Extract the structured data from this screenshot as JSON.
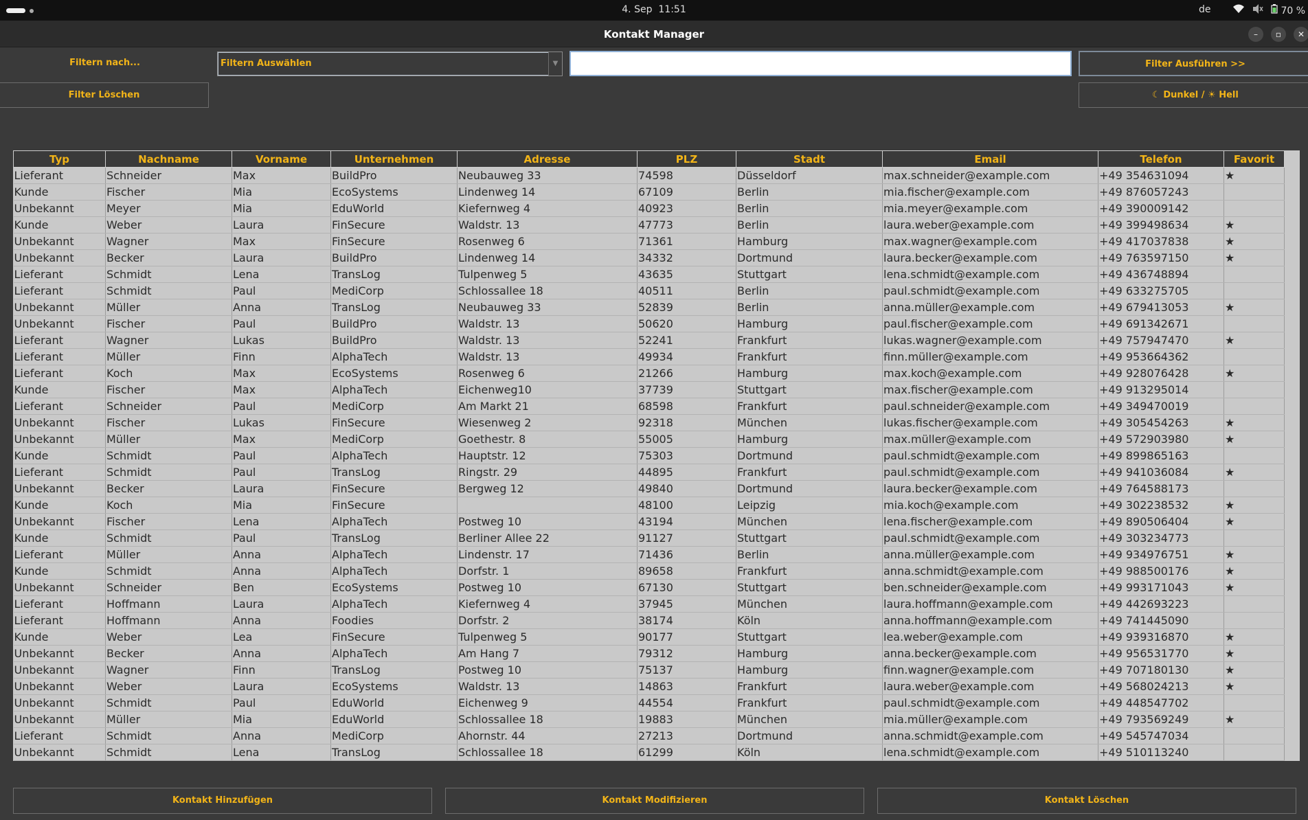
{
  "system": {
    "date": "4. Sep",
    "time": "11:51",
    "language": "de",
    "battery": "70 %"
  },
  "window": {
    "title": "Kontakt Manager"
  },
  "filters": {
    "filter_by_label": "Filtern nach...",
    "select_value": "Filtern Auswählen",
    "search_value": "",
    "execute_label": "Filter Ausführen >>",
    "clear_label": "Filter Löschen",
    "theme_toggle_label": "☾ Dunkel / ☀ Hell"
  },
  "table": {
    "columns": [
      "Typ",
      "Nachname",
      "Vorname",
      "Unternehmen",
      "Adresse",
      "PLZ",
      "Stadt",
      "Email",
      "Telefon",
      "Favorit"
    ],
    "rows": [
      [
        "Lieferant",
        "Schneider",
        "Max",
        "BuildPro",
        "Neubauweg 33",
        "74598",
        "Düsseldorf",
        "max.schneider@example.com",
        "+49 354631094",
        "★"
      ],
      [
        "Kunde",
        "Fischer",
        "Mia",
        "EcoSystems",
        "Lindenweg 14",
        "67109",
        "Berlin",
        "mia.fischer@example.com",
        "+49 876057243",
        ""
      ],
      [
        "Unbekannt",
        "Meyer",
        "Mia",
        "EduWorld",
        "Kiefernweg 4",
        "40923",
        "Berlin",
        "mia.meyer@example.com",
        "+49 390009142",
        ""
      ],
      [
        "Kunde",
        "Weber",
        "Laura",
        "FinSecure",
        "Waldstr. 13",
        "47773",
        "Berlin",
        "laura.weber@example.com",
        "+49 399498634",
        "★"
      ],
      [
        "Unbekannt",
        "Wagner",
        "Max",
        "FinSecure",
        "Rosenweg 6",
        "71361",
        "Hamburg",
        "max.wagner@example.com",
        "+49 417037838",
        "★"
      ],
      [
        "Unbekannt",
        "Becker",
        "Laura",
        "BuildPro",
        "Lindenweg 14",
        "34332",
        "Dortmund",
        "laura.becker@example.com",
        "+49 763597150",
        "★"
      ],
      [
        "Lieferant",
        "Schmidt",
        "Lena",
        "TransLog",
        "Tulpenweg 5",
        "43635",
        "Stuttgart",
        "lena.schmidt@example.com",
        "+49 436748894",
        ""
      ],
      [
        "Lieferant",
        "Schmidt",
        "Paul",
        "MediCorp",
        "Schlossallee 18",
        "40511",
        "Berlin",
        "paul.schmidt@example.com",
        "+49 633275705",
        ""
      ],
      [
        "Unbekannt",
        "Müller",
        "Anna",
        "TransLog",
        "Neubauweg 33",
        "52839",
        "Berlin",
        "anna.müller@example.com",
        "+49 679413053",
        "★"
      ],
      [
        "Unbekannt",
        "Fischer",
        "Paul",
        "BuildPro",
        "Waldstr. 13",
        "50620",
        "Hamburg",
        "paul.fischer@example.com",
        "+49 691342671",
        ""
      ],
      [
        "Lieferant",
        "Wagner",
        "Lukas",
        "BuildPro",
        "Waldstr. 13",
        "52241",
        "Frankfurt",
        "lukas.wagner@example.com",
        "+49 757947470",
        "★"
      ],
      [
        "Lieferant",
        "Müller",
        "Finn",
        "AlphaTech",
        "Waldstr. 13",
        "49934",
        "Frankfurt",
        "finn.müller@example.com",
        "+49 953664362",
        ""
      ],
      [
        "Lieferant",
        "Koch",
        "Max",
        "EcoSystems",
        "Rosenweg 6",
        "21266",
        "Hamburg",
        "max.koch@example.com",
        "+49 928076428",
        "★"
      ],
      [
        "Kunde",
        "Fischer",
        "Max",
        "AlphaTech",
        "Eichenweg10",
        "37739",
        "Stuttgart",
        "max.fischer@example.com",
        "+49 913295014",
        ""
      ],
      [
        "Lieferant",
        "Schneider",
        "Paul",
        "MediCorp",
        "Am Markt 21",
        "68598",
        "Frankfurt",
        "paul.schneider@example.com",
        "+49 349470019",
        ""
      ],
      [
        "Unbekannt",
        "Fischer",
        "Lukas",
        "FinSecure",
        "Wiesenweg 2",
        "92318",
        "München",
        "lukas.fischer@example.com",
        "+49 305454263",
        "★"
      ],
      [
        "Unbekannt",
        "Müller",
        "Max",
        "MediCorp",
        "Goethestr. 8",
        "55005",
        "Hamburg",
        "max.müller@example.com",
        "+49 572903980",
        "★"
      ],
      [
        "Kunde",
        "Schmidt",
        "Paul",
        "AlphaTech",
        "Hauptstr. 12",
        "75303",
        "Dortmund",
        "paul.schmidt@example.com",
        "+49 899865163",
        ""
      ],
      [
        "Lieferant",
        "Schmidt",
        "Paul",
        "TransLog",
        "Ringstr. 29",
        "44895",
        "Frankfurt",
        "paul.schmidt@example.com",
        "+49 941036084",
        "★"
      ],
      [
        "Unbekannt",
        "Becker",
        "Laura",
        "FinSecure",
        "Bergweg 12",
        "49840",
        "Dortmund",
        "laura.becker@example.com",
        "+49 764588173",
        ""
      ],
      [
        "Kunde",
        "Koch",
        "Mia",
        "FinSecure",
        "",
        "48100",
        "Leipzig",
        "mia.koch@example.com",
        "+49 302238532",
        "★"
      ],
      [
        "Unbekannt",
        "Fischer",
        "Lena",
        "AlphaTech",
        "Postweg 10",
        "43194",
        "München",
        "lena.fischer@example.com",
        "+49 890506404",
        "★"
      ],
      [
        "Kunde",
        "Schmidt",
        "Paul",
        "TransLog",
        "Berliner Allee 22",
        "91127",
        "Stuttgart",
        "paul.schmidt@example.com",
        "+49 303234773",
        ""
      ],
      [
        "Lieferant",
        "Müller",
        "Anna",
        "AlphaTech",
        "Lindenstr. 17",
        "71436",
        "Berlin",
        "anna.müller@example.com",
        "+49 934976751",
        "★"
      ],
      [
        "Kunde",
        "Schmidt",
        "Anna",
        "AlphaTech",
        "Dorfstr. 1",
        "89658",
        "Frankfurt",
        "anna.schmidt@example.com",
        "+49 988500176",
        "★"
      ],
      [
        "Unbekannt",
        "Schneider",
        "Ben",
        "EcoSystems",
        "Postweg 10",
        "67130",
        "Stuttgart",
        "ben.schneider@example.com",
        "+49 993171043",
        "★"
      ],
      [
        "Lieferant",
        "Hoffmann",
        "Laura",
        "AlphaTech",
        "Kiefernweg 4",
        "37945",
        "München",
        "laura.hoffmann@example.com",
        "+49 442693223",
        ""
      ],
      [
        "Lieferant",
        "Hoffmann",
        "Anna",
        "Foodies",
        "Dorfstr. 2",
        "38174",
        "Köln",
        "anna.hoffmann@example.com",
        "+49 741445090",
        ""
      ],
      [
        "Kunde",
        "Weber",
        "Lea",
        "FinSecure",
        "Tulpenweg 5",
        "90177",
        "Stuttgart",
        "lea.weber@example.com",
        "+49 939316870",
        "★"
      ],
      [
        "Unbekannt",
        "Becker",
        "Anna",
        "AlphaTech",
        "Am Hang 7",
        "79312",
        "Hamburg",
        "anna.becker@example.com",
        "+49 956531770",
        "★"
      ],
      [
        "Unbekannt",
        "Wagner",
        "Finn",
        "TransLog",
        "Postweg 10",
        "75137",
        "Hamburg",
        "finn.wagner@example.com",
        "+49 707180130",
        "★"
      ],
      [
        "Unbekannt",
        "Weber",
        "Laura",
        "EcoSystems",
        "Waldstr. 13",
        "14863",
        "Frankfurt",
        "laura.weber@example.com",
        "+49 568024213",
        "★"
      ],
      [
        "Unbekannt",
        "Schmidt",
        "Paul",
        "EduWorld",
        "Eichenweg 9",
        "44554",
        "Frankfurt",
        "paul.schmidt@example.com",
        "+49 448547702",
        ""
      ],
      [
        "Unbekannt",
        "Müller",
        "Mia",
        "EduWorld",
        "Schlossallee 18",
        "19883",
        "München",
        "mia.müller@example.com",
        "+49 793569249",
        "★"
      ],
      [
        "Lieferant",
        "Schmidt",
        "Anna",
        "MediCorp",
        "Ahornstr. 44",
        "27213",
        "Dortmund",
        "anna.schmidt@example.com",
        "+49 545747034",
        ""
      ],
      [
        "Unbekannt",
        "Schmidt",
        "Lena",
        "TransLog",
        "Schlossallee 18",
        "61299",
        "Köln",
        "lena.schmidt@example.com",
        "+49 510113240",
        ""
      ]
    ]
  },
  "actions": {
    "add_label": "Kontakt Hinzufügen",
    "modify_label": "Kontakt Modifizieren",
    "delete_label": "Kontakt Löschen"
  },
  "colors": {
    "accent": "#f2b418",
    "background": "#3a3a3a",
    "table_bg": "#c9c9c9"
  }
}
